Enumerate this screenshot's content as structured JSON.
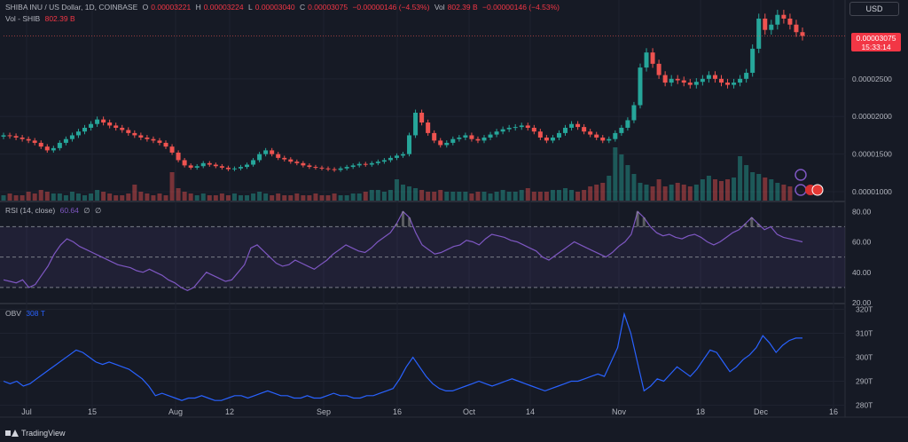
{
  "header": {
    "symbol": "SHIBA INU / US Dollar, 1D, COINBASE",
    "open_label": "O",
    "open": "0.00003221",
    "high_label": "H",
    "high": "0.00003224",
    "low_label": "L",
    "low": "0.00003040",
    "close_label": "C",
    "close": "0.00003075",
    "change": "−0.00000146 (−4.53%)",
    "vol_label": "Vol",
    "vol_value": "802.39 B",
    "change2": "−0.00000146 (−4.53%)"
  },
  "volume_legend": {
    "label": "Vol - SHIB",
    "value": "802.39 B"
  },
  "rsi_legend": {
    "label": "RSI (14, close)",
    "value": "60.64",
    "extra1": "∅",
    "extra2": "∅"
  },
  "obv_legend": {
    "label": "OBV",
    "value": "308 T"
  },
  "currency_button": "USD",
  "last_price_tag": {
    "price": "0.00003075",
    "countdown": "15:33:14"
  },
  "footer": {
    "brand": "TradingView"
  },
  "colors": {
    "up": "#26a69a",
    "down": "#ef5350",
    "rsi": "#7e57c2",
    "obv": "#2962ff",
    "bg": "#161a25",
    "grid": "#1f2330"
  },
  "chart_data": [
    {
      "type": "candlestick",
      "title": "SHIBA INU / US Dollar, 1D, COINBASE",
      "x_tick_labels": [
        "Jul",
        "15",
        "Aug",
        "12",
        "Sep",
        "16",
        "Oct",
        "14",
        "Nov",
        "18",
        "Dec",
        "16"
      ],
      "y_tick_labels": [
        "0.00001000",
        "0.00001500",
        "0.00002000",
        "0.00002500"
      ],
      "ylim": [
        9.3e-06,
        3.5e-05
      ],
      "close_series": [
        1.75e-05,
        1.74e-05,
        1.72e-05,
        1.7e-05,
        1.68e-05,
        1.65e-05,
        1.6e-05,
        1.55e-05,
        1.58e-05,
        1.65e-05,
        1.7e-05,
        1.75e-05,
        1.8e-05,
        1.85e-05,
        1.9e-05,
        1.96e-05,
        1.92e-05,
        1.88e-05,
        1.85e-05,
        1.82e-05,
        1.78e-05,
        1.75e-05,
        1.72e-05,
        1.7e-05,
        1.68e-05,
        1.65e-05,
        1.6e-05,
        1.52e-05,
        1.42e-05,
        1.35e-05,
        1.32e-05,
        1.34e-05,
        1.38e-05,
        1.36e-05,
        1.34e-05,
        1.32e-05,
        1.3e-05,
        1.31e-05,
        1.33e-05,
        1.36e-05,
        1.42e-05,
        1.5e-05,
        1.55e-05,
        1.5e-05,
        1.45e-05,
        1.43e-05,
        1.4e-05,
        1.38e-05,
        1.35e-05,
        1.33e-05,
        1.32e-05,
        1.31e-05,
        1.3e-05,
        1.29e-05,
        1.31e-05,
        1.33e-05,
        1.35e-05,
        1.37e-05,
        1.36e-05,
        1.38e-05,
        1.4e-05,
        1.42e-05,
        1.45e-05,
        1.48e-05,
        1.5e-05,
        1.75e-05,
        2.05e-05,
        1.92e-05,
        1.78e-05,
        1.68e-05,
        1.62e-05,
        1.65e-05,
        1.7e-05,
        1.72e-05,
        1.75e-05,
        1.7e-05,
        1.68e-05,
        1.72e-05,
        1.76e-05,
        1.8e-05,
        1.83e-05,
        1.85e-05,
        1.86e-05,
        1.88e-05,
        1.85e-05,
        1.8e-05,
        1.72e-05,
        1.68e-05,
        1.72e-05,
        1.78e-05,
        1.85e-05,
        1.9e-05,
        1.86e-05,
        1.8e-05,
        1.76e-05,
        1.72e-05,
        1.68e-05,
        1.7e-05,
        1.78e-05,
        1.85e-05,
        1.95e-05,
        2.15e-05,
        2.65e-05,
        2.85e-05,
        2.7e-05,
        2.55e-05,
        2.45e-05,
        2.5e-05,
        2.48e-05,
        2.45e-05,
        2.42e-05,
        2.46e-05,
        2.5e-05,
        2.55e-05,
        2.5e-05,
        2.45e-05,
        2.42e-05,
        2.45e-05,
        2.5e-05,
        2.58e-05,
        2.9e-05,
        3.3e-05,
        3.15e-05,
        3.22e-05,
        3.35e-05,
        3.3e-05,
        3.22e-05,
        3.12e-05,
        3.07e-05
      ],
      "volume_series": [
        3,
        4,
        3,
        3,
        5,
        4,
        6,
        5,
        4,
        4,
        3,
        5,
        4,
        3,
        4,
        6,
        5,
        4,
        3,
        3,
        4,
        9,
        5,
        4,
        3,
        4,
        3,
        16,
        7,
        5,
        4,
        3,
        4,
        3,
        3,
        4,
        3,
        4,
        3,
        3,
        4,
        5,
        4,
        3,
        4,
        3,
        3,
        4,
        3,
        3,
        4,
        3,
        3,
        4,
        3,
        3,
        4,
        4,
        5,
        6,
        6,
        5,
        6,
        12,
        9,
        8,
        7,
        6,
        5,
        5,
        6,
        5,
        5,
        5,
        5,
        4,
        5,
        5,
        4,
        5,
        6,
        5,
        5,
        6,
        7,
        5,
        5,
        5,
        6,
        6,
        7,
        6,
        5,
        6,
        8,
        9,
        10,
        14,
        30,
        26,
        20,
        15,
        10,
        9,
        8,
        12,
        8,
        9,
        10,
        9,
        8,
        9,
        12,
        14,
        12,
        11,
        12,
        13,
        25,
        20,
        16,
        15,
        13,
        12,
        10,
        9,
        8
      ]
    },
    {
      "type": "line",
      "title": "RSI (14, close)",
      "y_tick_labels": [
        "20.00",
        "40.00",
        "60.00",
        "80.00"
      ],
      "ylim": [
        20,
        86
      ],
      "overbought": 70,
      "middle": 50,
      "oversold": 30,
      "values": [
        35,
        34,
        33,
        35,
        30,
        32,
        38,
        44,
        52,
        58,
        62,
        60,
        57,
        55,
        53,
        51,
        49,
        47,
        45,
        44,
        43,
        41,
        40,
        42,
        40,
        38,
        35,
        33,
        30,
        28,
        30,
        35,
        40,
        38,
        36,
        34,
        35,
        40,
        45,
        56,
        58,
        54,
        50,
        46,
        44,
        45,
        48,
        46,
        44,
        42,
        45,
        48,
        52,
        55,
        58,
        56,
        54,
        53,
        56,
        60,
        63,
        66,
        72,
        80,
        76,
        66,
        58,
        55,
        52,
        53,
        55,
        57,
        58,
        61,
        60,
        58,
        62,
        65,
        64,
        63,
        61,
        60,
        58,
        56,
        54,
        50,
        48,
        51,
        54,
        57,
        60,
        58,
        56,
        54,
        52,
        50,
        53,
        57,
        60,
        65,
        80,
        76,
        70,
        66,
        64,
        65,
        63,
        62,
        64,
        65,
        63,
        60,
        58,
        60,
        63,
        66,
        68,
        72,
        76,
        72,
        68,
        70,
        65,
        63,
        62,
        61,
        60
      ],
      "values_note": "read approximately from the plotted RSI line"
    },
    {
      "type": "line",
      "title": "OBV",
      "y_tick_labels": [
        "280T",
        "290T",
        "300T",
        "310T",
        "320T"
      ],
      "ylim": [
        278,
        322
      ],
      "values": [
        290,
        289,
        290,
        288,
        289,
        291,
        293,
        295,
        297,
        299,
        301,
        303,
        302,
        300,
        298,
        297,
        298,
        297,
        296,
        295,
        293,
        291,
        288,
        284,
        285,
        284,
        283,
        282,
        283,
        283,
        284,
        283,
        282,
        282,
        283,
        284,
        284,
        283,
        284,
        285,
        286,
        285,
        284,
        284,
        283,
        283,
        284,
        283,
        283,
        284,
        285,
        284,
        284,
        283,
        283,
        284,
        284,
        285,
        286,
        287,
        291,
        296,
        300,
        296,
        292,
        289,
        287,
        286,
        286,
        287,
        288,
        289,
        290,
        289,
        288,
        289,
        290,
        291,
        290,
        289,
        288,
        287,
        286,
        287,
        288,
        289,
        290,
        290,
        291,
        292,
        293,
        292,
        298,
        304,
        318,
        310,
        298,
        286,
        288,
        291,
        290,
        293,
        296,
        294,
        292,
        295,
        299,
        303,
        302,
        298,
        294,
        296,
        299,
        301,
        304,
        309,
        306,
        302,
        305,
        307,
        308,
        308
      ],
      "values_note": "read approximately from the plotted OBV line"
    }
  ]
}
